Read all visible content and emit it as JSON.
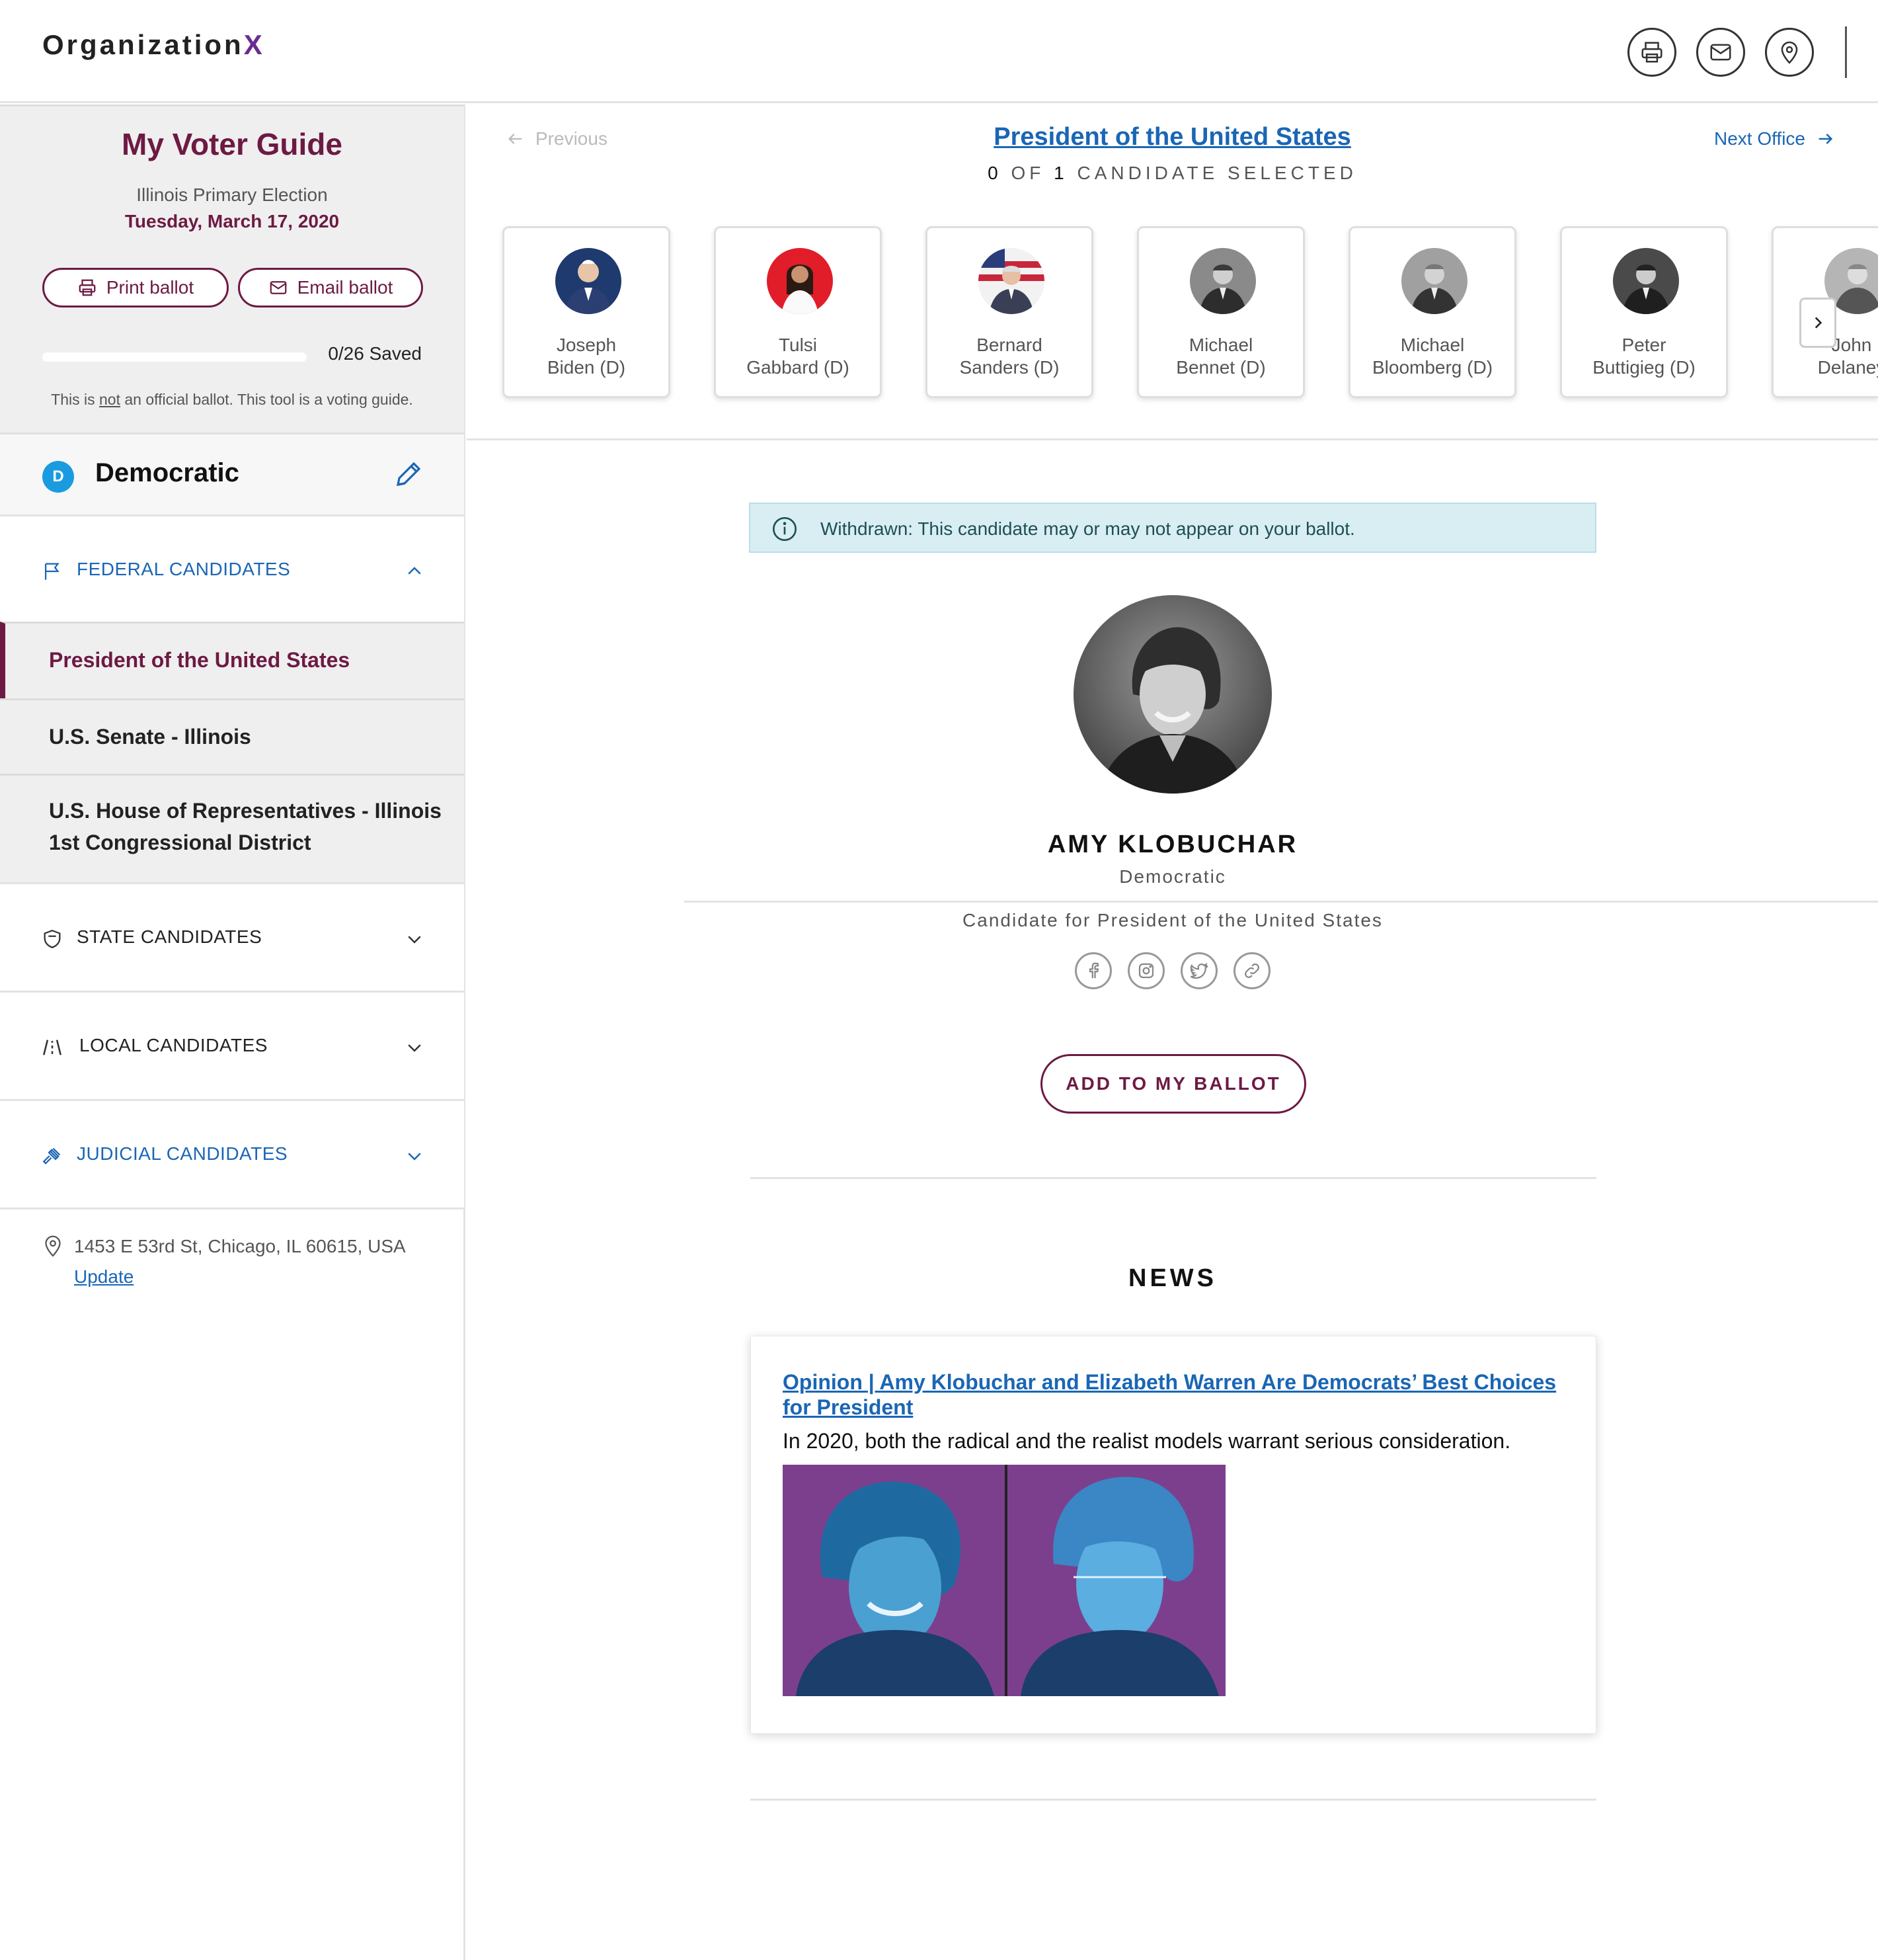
{
  "header": {
    "logo_main": "Organization",
    "logo_x": "X",
    "icons": [
      "printer-icon",
      "envelope-icon",
      "map-pin-icon"
    ]
  },
  "sidebar": {
    "title": "My Voter Guide",
    "election": "Illinois Primary Election",
    "date": "Tuesday, March 17, 2020",
    "print_label": "Print ballot",
    "email_label": "Email ballot",
    "progress": {
      "saved": 0,
      "total": 26,
      "label": "0/26 Saved"
    },
    "disclaimer_pre": "This is ",
    "disclaimer_not": "not",
    "disclaimer_post": " an official ballot. This tool is a voting guide.",
    "party": {
      "badge": "D",
      "name": "Democratic"
    },
    "sections": {
      "federal": "FEDERAL CANDIDATES",
      "state": "STATE CANDIDATES",
      "local": "LOCAL CANDIDATES",
      "judicial": "JUDICIAL CANDIDATES"
    },
    "offices": [
      {
        "line1": "President of the United States"
      },
      {
        "line1": "U.S. Senate - Illinois"
      },
      {
        "line1": "U.S. House of Representatives - Illinois",
        "line2": "1st Congressional District"
      }
    ],
    "address": "1453 E 53rd St, Chicago, IL 60615, USA",
    "update_label": "Update"
  },
  "main": {
    "prev_label": "Previous",
    "next_label": "Next Office",
    "office_title": "President of the United States",
    "count": {
      "selected": "0",
      "of": "OF",
      "total": "1",
      "suffix": "CANDIDATE SELECTED"
    },
    "candidates": [
      {
        "first": "Joseph",
        "last": "Biden (D)"
      },
      {
        "first": "Tulsi",
        "last": "Gabbard (D)"
      },
      {
        "first": "Bernard",
        "last": "Sanders (D)"
      },
      {
        "first": "Michael",
        "last": "Bennet (D)"
      },
      {
        "first": "Michael",
        "last": "Bloomberg (D)"
      },
      {
        "first": "Peter",
        "last": "Buttigieg (D)"
      },
      {
        "first": "John",
        "last": "Delaney"
      }
    ],
    "banner": "Withdrawn: This candidate may or may not appear on your ballot.",
    "candidate": {
      "name": "AMY KLOBUCHAR",
      "party": "Democratic",
      "office": "Candidate for President of the United States",
      "social_icons": [
        "facebook-icon",
        "instagram-icon",
        "twitter-icon",
        "link-icon"
      ]
    },
    "add_label": "ADD TO MY BALLOT",
    "news_heading": "NEWS",
    "news": {
      "headline": "Opinion | Amy Klobuchar and Elizabeth Warren Are Democrats’ Best Choices for President",
      "summary": "In 2020, both the radical and the realist models warrant serious consideration."
    }
  },
  "colors": {
    "brand": "#6d1a43",
    "link": "#1a66b5",
    "party_badge": "#1a9be0",
    "banner_bg": "#d8eef3",
    "logo_x": "#6a2c91"
  }
}
